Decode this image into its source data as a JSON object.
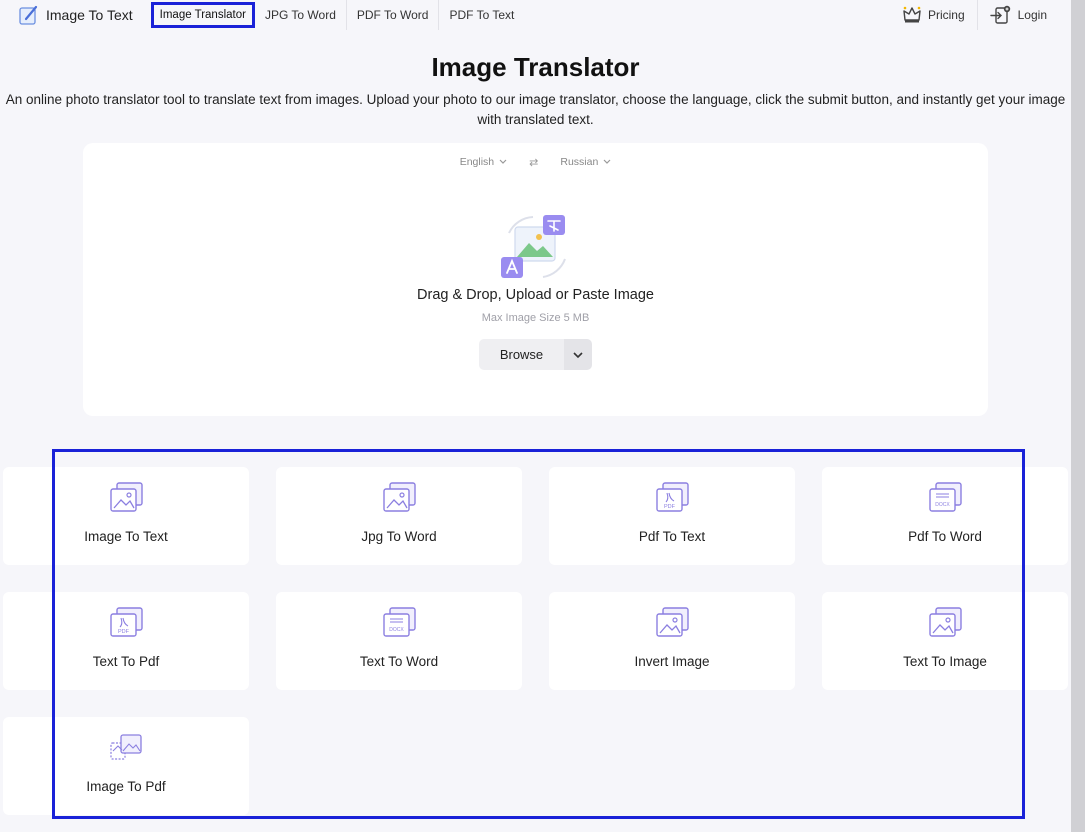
{
  "nav": {
    "logo_text": "Image To Text",
    "links": [
      "Image Translator",
      "JPG To Word",
      "PDF To Word",
      "PDF To Text"
    ],
    "pricing": "Pricing",
    "login": "Login"
  },
  "hero": {
    "title": "Image Translator",
    "subtitle": "An online photo translator tool to translate text from images. Upload your photo to our image translator, choose the language, click the submit button, and instantly get your image with translated text."
  },
  "upload": {
    "source_lang": "English",
    "target_lang": "Russian",
    "swap_symbol": "⇄",
    "title": "Drag & Drop, Upload or Paste Image",
    "max_size": "Max Image Size 5 MB",
    "browse": "Browse"
  },
  "tools": [
    {
      "label": "Image To Text",
      "icon": "image-icon"
    },
    {
      "label": "Jpg To Word",
      "icon": "image-icon"
    },
    {
      "label": "Pdf To Text",
      "icon": "pdf-icon"
    },
    {
      "label": "Pdf To Word",
      "icon": "docx-icon"
    },
    {
      "label": "Text To Pdf",
      "icon": "pdf-icon"
    },
    {
      "label": "Text To Word",
      "icon": "docx-icon"
    },
    {
      "label": "Invert Image",
      "icon": "image-icon"
    },
    {
      "label": "Text To Image",
      "icon": "image-icon"
    },
    {
      "label": "Image To Pdf",
      "icon": "image-pdf-icon"
    }
  ],
  "colors": {
    "accent": "#8b7fe0",
    "highlight": "#1a22d8",
    "background": "#f6f6fa"
  }
}
